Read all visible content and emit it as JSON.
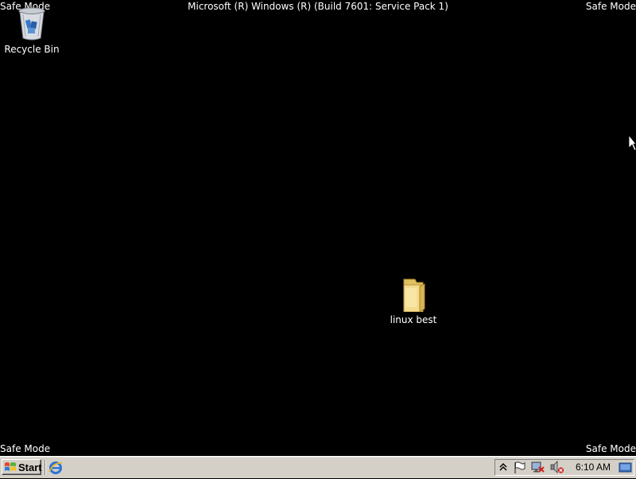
{
  "overlay": {
    "top_left": "Safe Mode",
    "top_right": "Safe Mode",
    "bottom_left": "Safe Mode",
    "bottom_right": "Safe Mode",
    "build": "Microsoft (R) Windows (R) (Build 7601: Service Pack 1)"
  },
  "desktop_icons": [
    {
      "label": "Recycle Bin",
      "icon": "recycle-bin-icon"
    },
    {
      "label": "linux best",
      "icon": "folder-icon"
    }
  ],
  "taskbar": {
    "start_label": "Start",
    "quick_launch": [
      {
        "icon": "internet-explorer-icon"
      }
    ],
    "tray_icons": [
      "show-hidden-icons",
      "action-center-flag-icon",
      "network-disconnected-icon",
      "volume-muted-icon"
    ],
    "clock": "6:10 AM",
    "show_desktop_icon": "show-desktop-icon"
  },
  "colors": {
    "desktop_background": "#000000",
    "taskbar": "#d4d0c8",
    "overlay_text": "#ffffff"
  }
}
